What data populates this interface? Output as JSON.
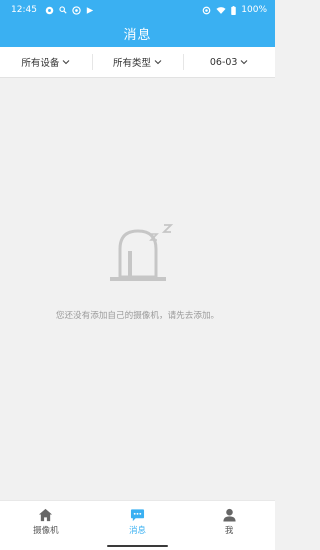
{
  "status": {
    "time": "12:45",
    "battery": "100%"
  },
  "header": {
    "title": "消息"
  },
  "filters": [
    {
      "label": "所有设备"
    },
    {
      "label": "所有类型"
    },
    {
      "label": "06-03"
    }
  ],
  "empty_state": {
    "message": "您还没有添加自己的摄像机，请先去添加。",
    "sleep_mark": "z z"
  },
  "tabbar": {
    "tabs": [
      {
        "label": "摄像机",
        "icon": "home-icon",
        "active": false
      },
      {
        "label": "消息",
        "icon": "message-icon",
        "active": true
      },
      {
        "label": "我",
        "icon": "person-icon",
        "active": false
      }
    ]
  },
  "colors": {
    "accent": "#3ab0f2",
    "background": "#f1f1f1",
    "icon_gray": "#c6c6c6"
  }
}
